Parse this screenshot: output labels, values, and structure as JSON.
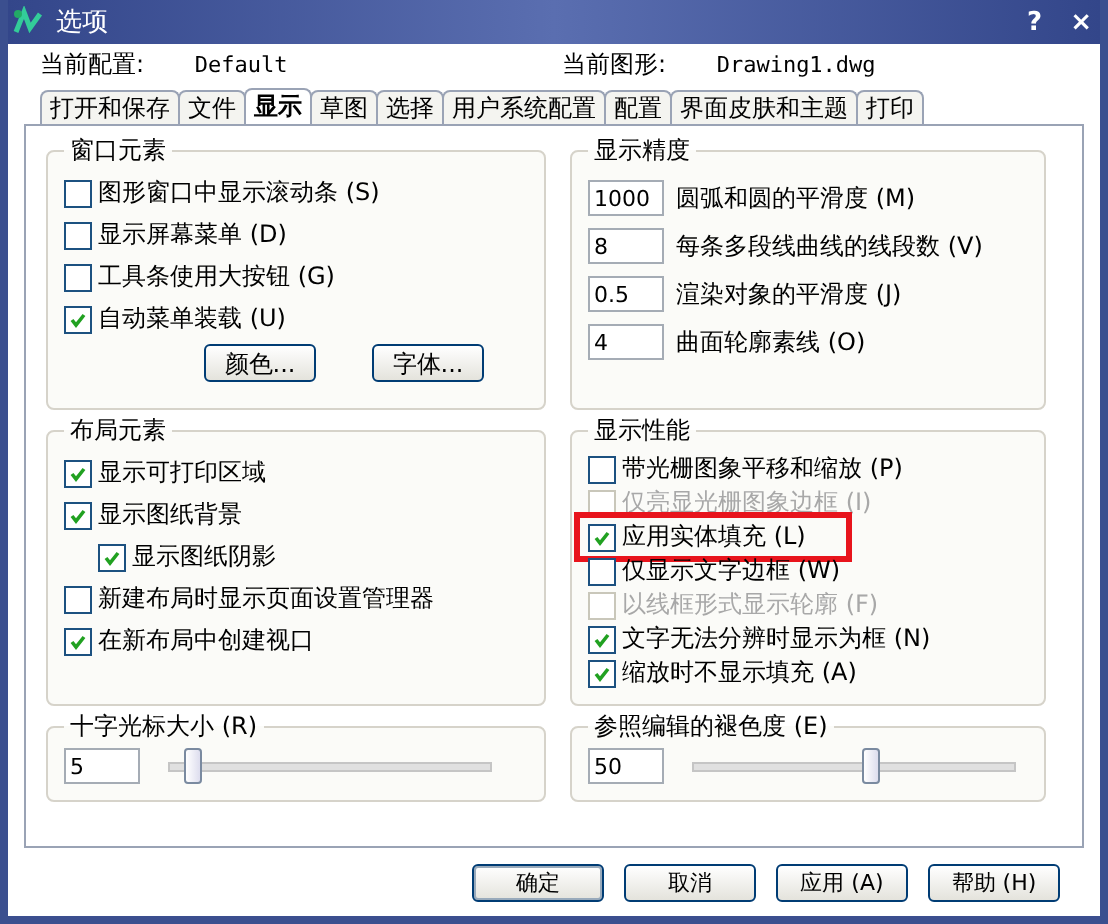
{
  "window": {
    "title": "选项",
    "help": "?",
    "close": "×"
  },
  "profile": {
    "label": "当前配置:",
    "value": "Default"
  },
  "drawing": {
    "label": "当前图形:",
    "value": "Drawing1.dwg"
  },
  "tabs": [
    {
      "label": "打开和保存",
      "selected": false
    },
    {
      "label": "文件",
      "selected": false
    },
    {
      "label": "显示",
      "selected": true
    },
    {
      "label": "草图",
      "selected": false
    },
    {
      "label": "选择",
      "selected": false
    },
    {
      "label": "用户系统配置",
      "selected": false
    },
    {
      "label": "配置",
      "selected": false
    },
    {
      "label": "界面皮肤和主题",
      "selected": false
    },
    {
      "label": "打印",
      "selected": false
    }
  ],
  "window_elements": {
    "title": "窗口元素",
    "options": [
      {
        "label": "图形窗口中显示滚动条 (S)",
        "checked": false,
        "disabled": false
      },
      {
        "label": "显示屏幕菜单 (D)",
        "checked": false,
        "disabled": false
      },
      {
        "label": "工具条使用大按钮 (G)",
        "checked": false,
        "disabled": false
      },
      {
        "label": "自动菜单装载 (U)",
        "checked": true,
        "disabled": false
      }
    ],
    "buttons": [
      "颜色...",
      "字体..."
    ]
  },
  "layout_elements": {
    "title": "布局元素",
    "options": [
      {
        "label": "显示可打印区域",
        "checked": true
      },
      {
        "label": "显示图纸背景",
        "checked": true,
        "children": [
          {
            "label": "显示图纸阴影",
            "checked": true
          }
        ]
      },
      {
        "label": "新建布局时显示页面设置管理器",
        "checked": false
      },
      {
        "label": "在新布局中创建视口",
        "checked": true
      }
    ]
  },
  "crosshair": {
    "title": "十字光标大小 (R)",
    "value": "5",
    "level": 0.07
  },
  "precision": {
    "title": "显示精度",
    "fields": [
      {
        "value": "1000",
        "label": "圆弧和圆的平滑度 (M)"
      },
      {
        "value": "8",
        "label": "每条多段线曲线的线段数 (V)"
      },
      {
        "value": "0.5",
        "label": "渲染对象的平滑度 (J)"
      },
      {
        "value": "4",
        "label": "曲面轮廓素线 (O)"
      }
    ]
  },
  "performance": {
    "title": "显示性能",
    "options": [
      {
        "label": "带光栅图象平移和缩放 (P)",
        "checked": false,
        "disabled": false,
        "highlighted": false
      },
      {
        "label": "仅亮显光栅图象边框 (I)",
        "checked": false,
        "disabled": true,
        "highlighted": false
      },
      {
        "label": "应用实体填充 (L)",
        "checked": true,
        "disabled": false,
        "highlighted": true
      },
      {
        "label": "仅显示文字边框 (W)",
        "checked": false,
        "disabled": false,
        "highlighted": false
      },
      {
        "label": "以线框形式显示轮廓 (F)",
        "checked": false,
        "disabled": true,
        "highlighted": false
      },
      {
        "label": "文字无法分辨时显示为框 (N)",
        "checked": true,
        "disabled": false,
        "highlighted": false
      },
      {
        "label": "缩放时不显示填充 (A)",
        "checked": true,
        "disabled": false,
        "highlighted": false
      }
    ]
  },
  "fade": {
    "title": "参照编辑的褪色度 (E)",
    "value": "50",
    "level": 0.55
  },
  "buttons": [
    "确定",
    "取消",
    "应用 (A)",
    "帮助 (H)"
  ]
}
